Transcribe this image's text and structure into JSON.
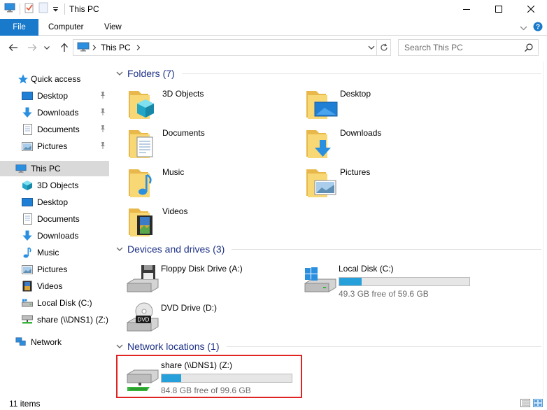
{
  "window": {
    "title": "This PC"
  },
  "ribbon": {
    "file": "File",
    "computer": "Computer",
    "view": "View"
  },
  "address": {
    "location": "This PC"
  },
  "search": {
    "placeholder": "Search This PC"
  },
  "nav": {
    "quick_access": "Quick access",
    "quick_items": [
      "Desktop",
      "Downloads",
      "Documents",
      "Pictures"
    ],
    "this_pc": "This PC",
    "pc_items": [
      "3D Objects",
      "Desktop",
      "Documents",
      "Downloads",
      "Music",
      "Pictures",
      "Videos",
      "Local Disk (C:)",
      "share (\\\\DNS1) (Z:)"
    ],
    "network": "Network"
  },
  "groups": {
    "folders": {
      "title": "Folders (7)",
      "items": [
        "3D Objects",
        "Desktop",
        "Documents",
        "Downloads",
        "Music",
        "Pictures",
        "Videos"
      ]
    },
    "devices": {
      "title": "Devices and drives (3)",
      "items": [
        {
          "name": "Floppy Disk Drive (A:)"
        },
        {
          "name": "Local Disk (C:)",
          "free_text": "49.3 GB free of 59.6 GB",
          "used_fraction": 0.173
        },
        {
          "name": "DVD Drive (D:)"
        }
      ]
    },
    "network": {
      "title": "Network locations (1)",
      "items": [
        {
          "name": "share (\\\\DNS1) (Z:)",
          "free_text": "84.8 GB free of 99.6 GB",
          "used_fraction": 0.149
        }
      ]
    }
  },
  "status": {
    "item_count": "11 items"
  },
  "colors": {
    "accent": "#1979ca",
    "group_title": "#1e3287",
    "bar_fill": "#26a0da",
    "highlight": "#e02424",
    "folder": "#f8d775"
  }
}
